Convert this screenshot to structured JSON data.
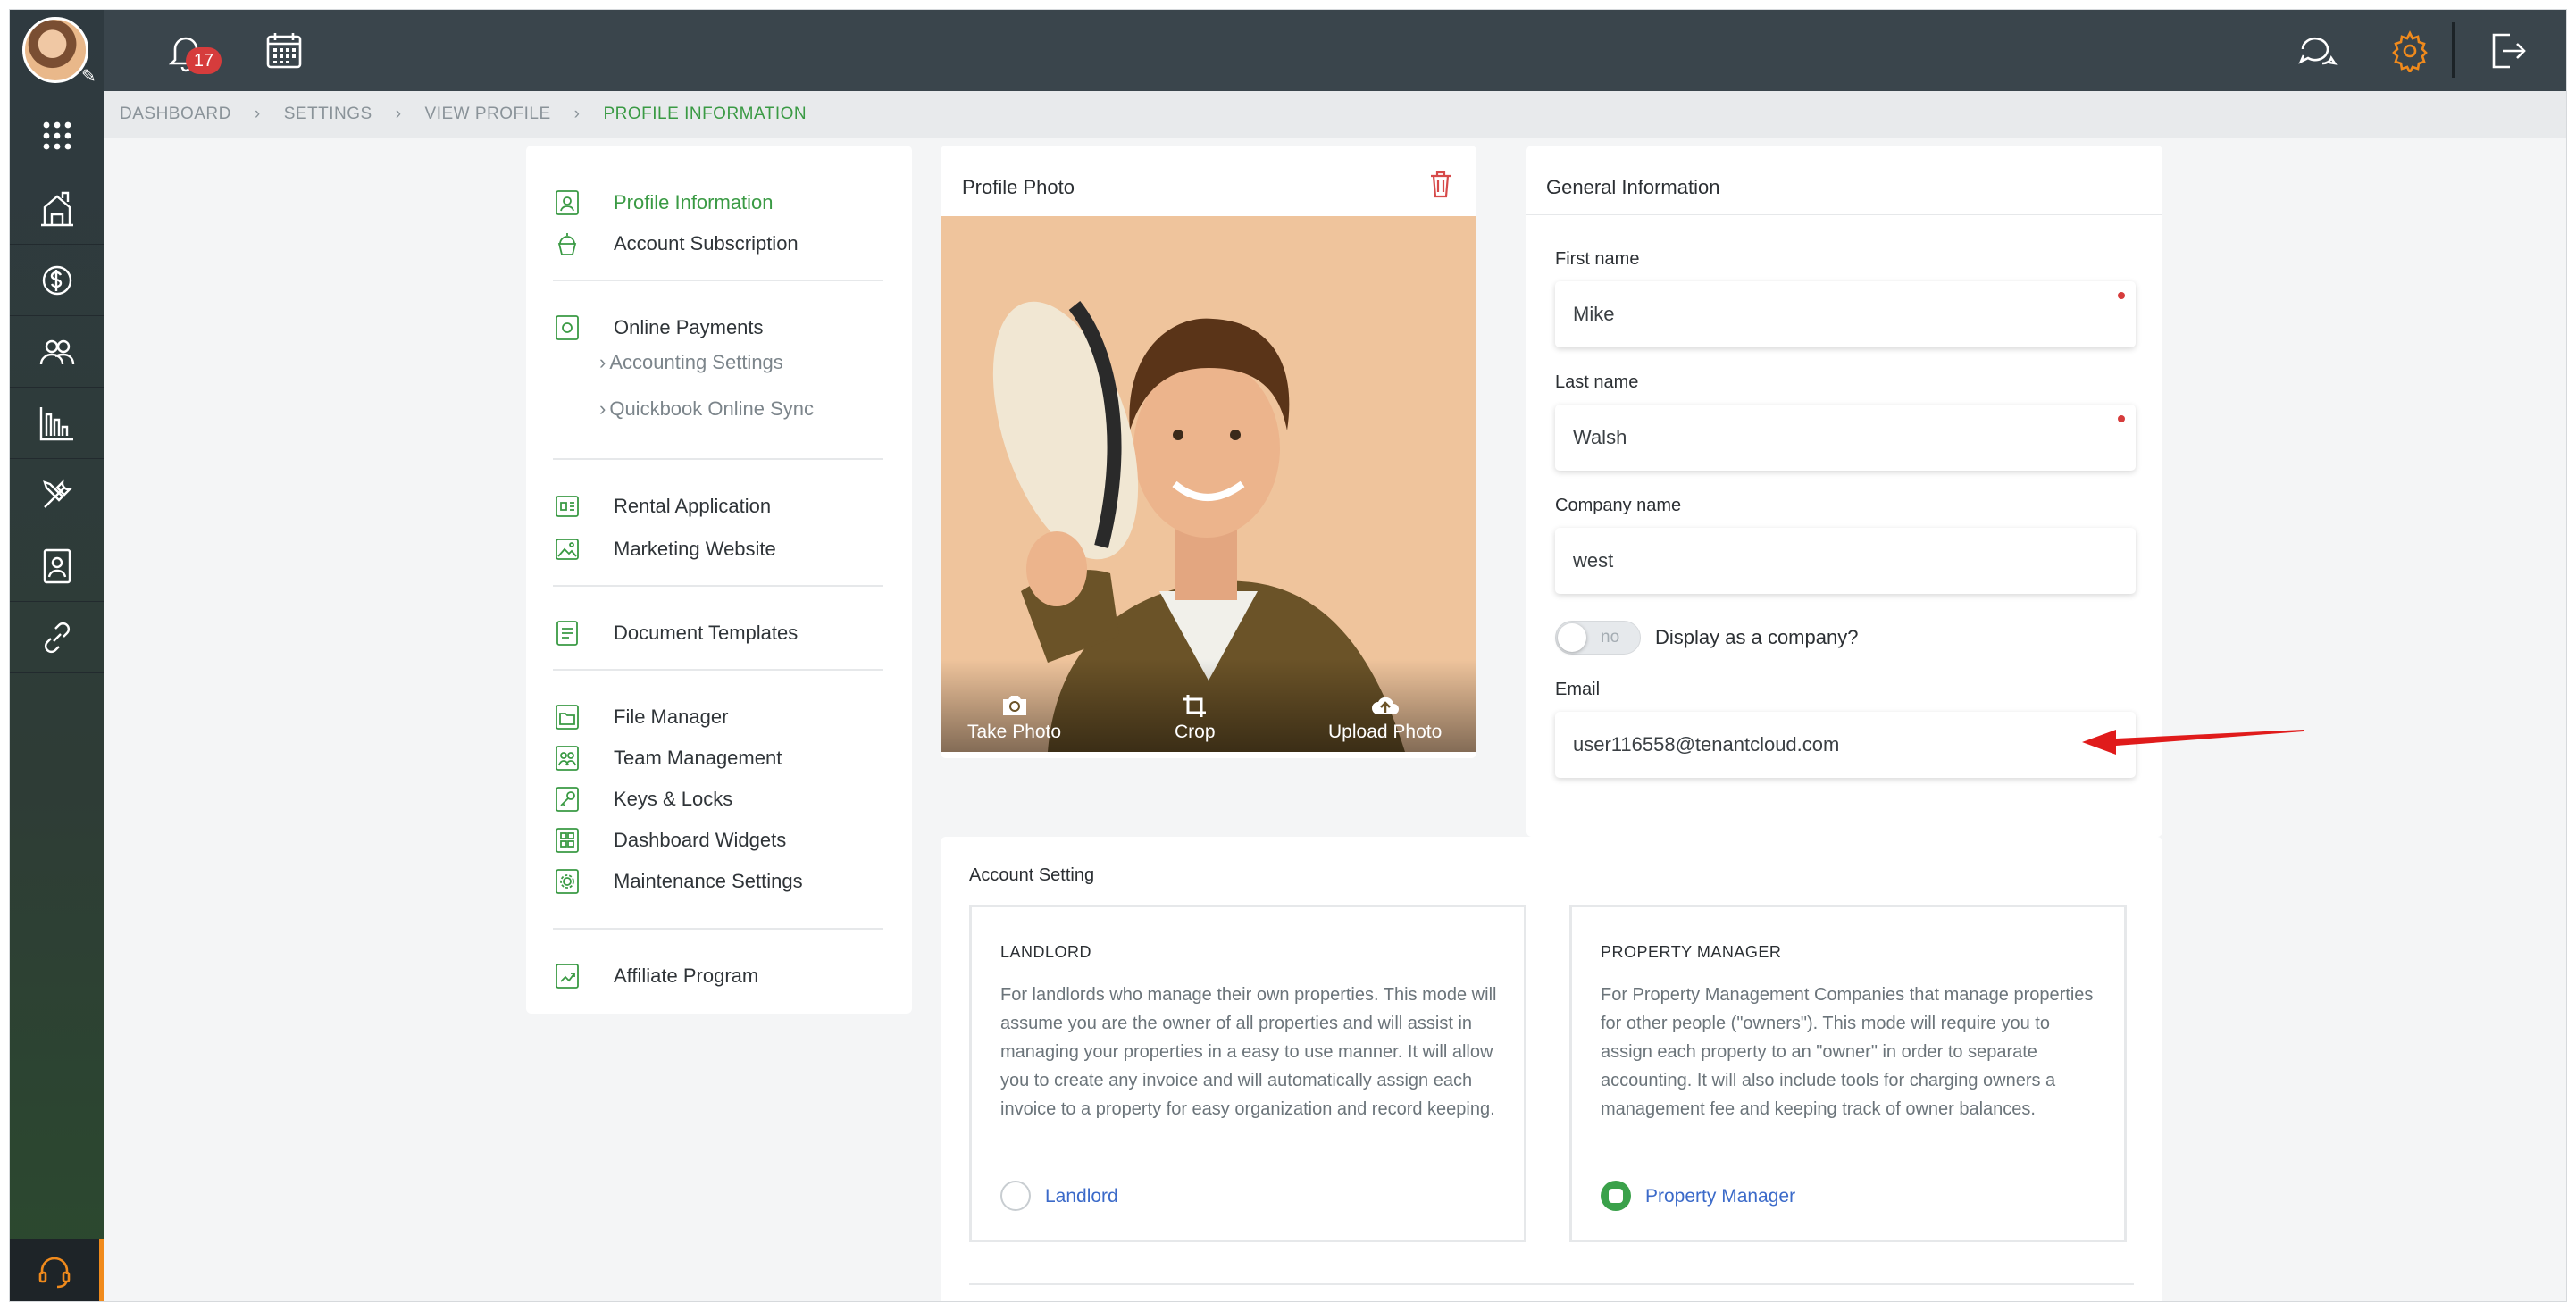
{
  "topbar": {
    "notifications_count": "17",
    "icons": [
      "bell-icon",
      "calendar-icon",
      "chat-icon",
      "gear-icon",
      "logout-icon"
    ]
  },
  "sidebar": {
    "icons": [
      "apps-grid-icon",
      "properties-icon",
      "payments-icon",
      "tenants-icon",
      "reports-icon",
      "maintenance-tools-icon",
      "documents-icon",
      "integrations-link-icon",
      "support-headset-icon"
    ]
  },
  "breadcrumb": {
    "items": [
      "DASHBOARD",
      "SETTINGS",
      "VIEW PROFILE"
    ],
    "current": "PROFILE INFORMATION"
  },
  "settings_menu": {
    "group1": [
      "Profile Information",
      "Account Subscription"
    ],
    "group2": {
      "main": "Online Payments",
      "subs": [
        "Accounting Settings",
        "Quickbook Online Sync"
      ]
    },
    "group3": [
      "Rental Application",
      "Marketing Website"
    ],
    "group4": [
      "Document Templates"
    ],
    "group5": [
      "File Manager",
      "Team Management",
      "Keys & Locks",
      "Dashboard Widgets",
      "Maintenance Settings"
    ],
    "group6": [
      "Affiliate Program"
    ],
    "active": "Profile Information"
  },
  "profile_photo": {
    "title": "Profile Photo",
    "actions": [
      "Take Photo",
      "Crop",
      "Upload Photo"
    ]
  },
  "general_info": {
    "title": "General Information",
    "first_name_label": "First name",
    "first_name_value": "Mike",
    "last_name_label": "Last name",
    "last_name_value": "Walsh",
    "company_label": "Company name",
    "company_value": "west",
    "toggle_state": "no",
    "toggle_label": "Display as a company?",
    "email_label": "Email",
    "email_value": "user116558@tenantcloud.com"
  },
  "account_setting": {
    "title": "Account Setting",
    "landlord": {
      "heading": "LANDLORD",
      "description": "For landlords who manage their own properties. This mode will assume you are the owner of all properties and will assist in managing your properties in a easy to use manner. It will allow you to create any invoice and will automatically assign each invoice to a property for easy organization and record keeping.",
      "option_label": "Landlord",
      "selected": false
    },
    "property_manager": {
      "heading": "PROPERTY MANAGER",
      "description": "For Property Management Companies that manage properties for other people (\"owners\"). This mode will require you to assign each property to an \"owner\" in order to separate accounting. It will also include tools for charging owners a management fee and keeping track of owner balances.",
      "option_label": "Property Manager",
      "selected": true
    }
  },
  "colors": {
    "accent_green": "#3a9a44",
    "topbar": "#3a454c",
    "link_blue": "#3b6ac9",
    "alert_red": "#d63c3c",
    "settings_orange": "#f08a1c"
  }
}
